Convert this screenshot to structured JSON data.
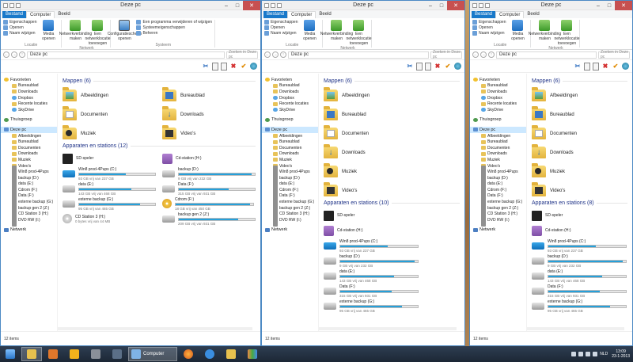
{
  "window_title": "Deze pc",
  "ribbon": {
    "tabs": [
      "Bestand",
      "Computer",
      "Beeld"
    ],
    "groups": {
      "locatie": {
        "label": "Locatie",
        "small": [
          "Eigenschappen",
          "Openen",
          "Naam wijzigen"
        ],
        "big": "Media openen"
      },
      "netwerk": {
        "label": "Netwerk",
        "items": [
          "Netwerkverbinding maken",
          "Een netwerklocatie toevoegen"
        ]
      },
      "systeem": {
        "label": "Systeem",
        "big": "Configuratiescherm openen",
        "small": [
          "Een programma verwijderen of wijzigen",
          "Systeemeigenschappen",
          "Beheren"
        ]
      }
    }
  },
  "nav": {
    "address": "Deze pc",
    "search_placeholder": "Zoeken in Deze pc"
  },
  "navpane": {
    "favorites_head": "Favorieten",
    "favorites": [
      "Bureaublad",
      "Downloads",
      "Dropbox",
      "Recente locaties",
      "SkyDrive"
    ],
    "homegroup": "Thuisgroep",
    "thispc_head": "Deze pc",
    "thispc": [
      "Afbeeldingen",
      "Bureaublad",
      "Documenten",
      "Downloads",
      "Muziek",
      "Video's",
      "Win8 prod-4Pups",
      "backup (D:)",
      "data (E:)",
      "Cdrom (F:)",
      "Data (F:)",
      "externe backup (G:)",
      "backup gen 2 (Z:)",
      "CD Station 3 (H:)",
      "DVD RW (I:)"
    ],
    "network": "Netwerk"
  },
  "sections": {
    "folders": "Mappen (6)",
    "devices": "Apparaten en stations (12)",
    "devices_w2": "Apparaten en stations (10)",
    "devices_w3": "Apparaten en stations (8)"
  },
  "folders": [
    {
      "name": "Afbeeldingen",
      "ov": "pic"
    },
    {
      "name": "Bureaublad",
      "ov": "desk"
    },
    {
      "name": "Documenten",
      "ov": "doc"
    },
    {
      "name": "Downloads",
      "ov": "down"
    },
    {
      "name": "Muziek",
      "ov": "music"
    },
    {
      "name": "Video's",
      "ov": "vid"
    }
  ],
  "drives": [
    {
      "name": "SD-speler",
      "sub": "",
      "used": null,
      "icon": "app"
    },
    {
      "name": "Cd-station (H:)",
      "sub": "",
      "used": null,
      "icon": "ext"
    },
    {
      "name": "Win8 prod-4Pups (C:)",
      "sub": "93 GB vrij van 237 GB",
      "used": 0.61,
      "icon": "win8"
    },
    {
      "name": "backup (D:)",
      "sub": "9 GB vrij van 232 GB",
      "used": 0.96,
      "icon": "hdd"
    },
    {
      "name": "data (E:)",
      "sub": "143 GB vrij van 468 GB",
      "used": 0.69,
      "icon": "hdd"
    },
    {
      "name": "Data (F:)",
      "sub": "315 GB vrij van 931 GB",
      "used": 0.66,
      "icon": "hdd"
    },
    {
      "name": "externe backup (G:)",
      "sub": "95 GB vrij van 465 GB",
      "used": 0.8,
      "icon": "hdd"
    },
    {
      "name": "Cdrom (F:)",
      "sub": "18 GB vrij van 450 GB",
      "used": 0.96,
      "icon": "cd"
    },
    {
      "name": "CD Station 3 (H:)",
      "sub": "0 bytes vrij van 44 MB",
      "used": null,
      "icon": "cd2"
    },
    {
      "name": "backup gen 2 (Z:)",
      "sub": "209 GB vrij van 931 GB",
      "used": 0.78,
      "icon": "hdd"
    }
  ],
  "status": "12 items",
  "taskbar": {
    "explorer_label": "Computer"
  },
  "tray": {
    "lang": "NLD",
    "time": "13:09",
    "date": "23-1-2013"
  },
  "colors": {
    "ribbon_file_tab": "#1979ca",
    "bar_fill": "#26a0da",
    "close_button": "#c75050"
  }
}
